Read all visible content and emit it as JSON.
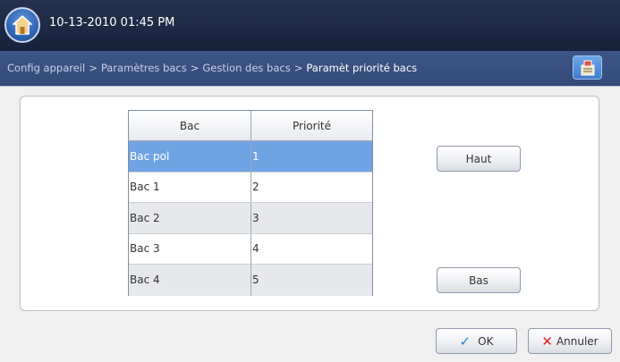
{
  "header": {
    "datetime": "10-13-2010 01:45 PM"
  },
  "breadcrumb": {
    "items": [
      "Config appareil",
      "Paramètres bacs",
      "Gestion des bacs"
    ],
    "current": "Paramèt priorité bacs",
    "separator": ">"
  },
  "table": {
    "headers": [
      "Bac",
      "Priorité"
    ],
    "rows": [
      {
        "bac": "Bac pol",
        "priorite": "1",
        "selected": true
      },
      {
        "bac": "Bac 1",
        "priorite": "2"
      },
      {
        "bac": "Bac 2",
        "priorite": "3"
      },
      {
        "bac": "Bac 3",
        "priorite": "4"
      },
      {
        "bac": "Bac 4",
        "priorite": "5"
      }
    ]
  },
  "buttons": {
    "up": "Haut",
    "down": "Bas",
    "ok": "OK",
    "cancel": "Annuler"
  },
  "icons": {
    "home": "home-icon",
    "job": "job-status-icon",
    "ok": "checkmark-icon",
    "cancel": "x-icon"
  },
  "colors": {
    "topbar": "#1d2a45",
    "pathbar": "#3a5283",
    "selected_row": "#6fa4e4"
  }
}
